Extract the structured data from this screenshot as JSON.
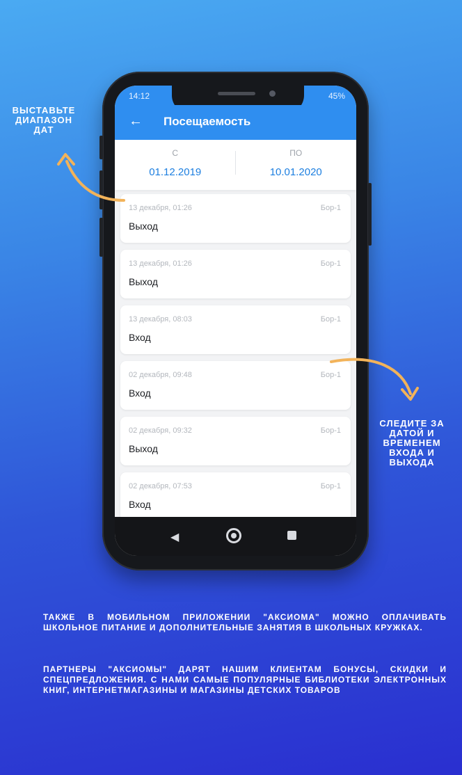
{
  "status_bar": {
    "time": "14:12",
    "battery": "45%"
  },
  "app_bar": {
    "title": "Посещаемость"
  },
  "date_range": {
    "from_label": "С",
    "from_value": "01.12.2019",
    "to_label": "ПО",
    "to_value": "10.01.2020"
  },
  "entries": [
    {
      "date": "13 декабря, 01:26",
      "location": "Бор-1",
      "type": "Выход"
    },
    {
      "date": "13 декабря, 01:26",
      "location": "Бор-1",
      "type": "Выход"
    },
    {
      "date": "13 декабря, 08:03",
      "location": "Бор-1",
      "type": "Вход"
    },
    {
      "date": "02 декабря, 09:48",
      "location": "Бор-1",
      "type": "Вход"
    },
    {
      "date": "02 декабря, 09:32",
      "location": "Бор-1",
      "type": "Выход"
    },
    {
      "date": "02 декабря, 07:53",
      "location": "Бор-1",
      "type": "Вход"
    }
  ],
  "nav_bar": {
    "back_icon": "triangle-back-icon",
    "home_icon": "circle-home-icon",
    "recent_icon": "square-recent-icon"
  },
  "callouts": {
    "left": "Выставьте диапазон дат",
    "right": "Следите за датой и временем входа и выхода"
  },
  "paragraphs": [
    "Также в мобильном приложении \"Аксиома\" можно оплачивать школьное питание и дополнительные занятия в школьных кружках.",
    "Партнеры \"Аксиомы\" дарят нашим клиентам бонусы, скидки и спецпредложения. С нами самые популярные библиотеки электронных книг, интернетмагазины и магазины детских товаров"
  ],
  "colors": {
    "app_blue": "#2f8ef0",
    "arrow_orange": "#f2b35a"
  }
}
